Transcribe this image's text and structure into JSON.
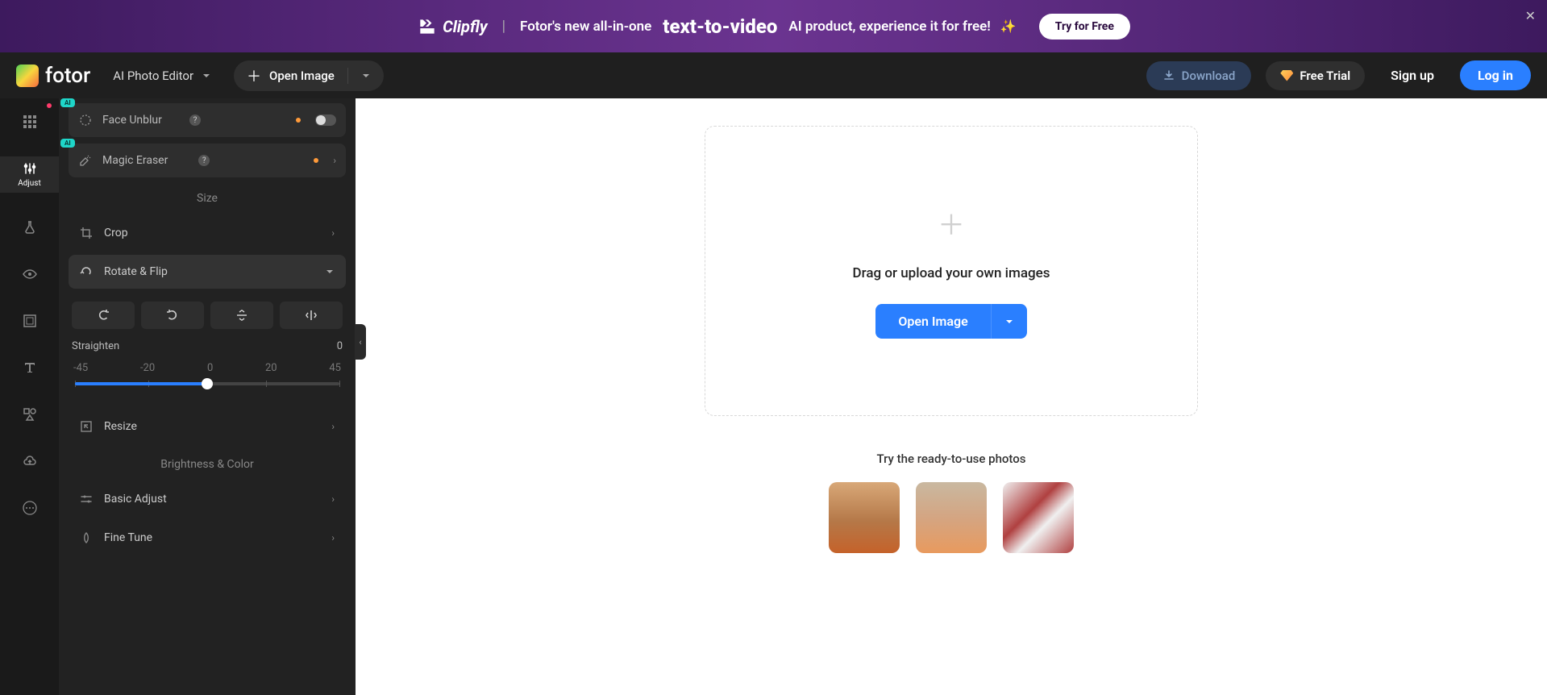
{
  "banner": {
    "brand": "Clipfly",
    "pre": "Fotor's new all-in-one",
    "highlight": "text-to-video",
    "post": "AI product, experience it for free!",
    "cta": "Try for Free"
  },
  "header": {
    "logo_text": "fotor",
    "editor_dd": "AI Photo Editor",
    "open_image": "Open Image",
    "download": "Download",
    "free_trial": "Free Trial",
    "sign_up": "Sign up",
    "log_in": "Log in"
  },
  "rail": {
    "adjust": "Adjust"
  },
  "panel": {
    "face_unblur": "Face Unblur",
    "magic_eraser": "Magic Eraser",
    "size": "Size",
    "crop": "Crop",
    "rotate_flip": "Rotate & Flip",
    "straighten_label": "Straighten",
    "straighten_value": "0",
    "ticks": {
      "n45": "-45",
      "n20": "-20",
      "z": "0",
      "p20": "20",
      "p45": "45"
    },
    "resize": "Resize",
    "bc": "Brightness & Color",
    "basic_adjust": "Basic Adjust",
    "fine_tune": "Fine Tune"
  },
  "canvas": {
    "drag_text": "Drag or upload your own images",
    "open_image": "Open Image",
    "try_title": "Try the ready-to-use photos"
  }
}
